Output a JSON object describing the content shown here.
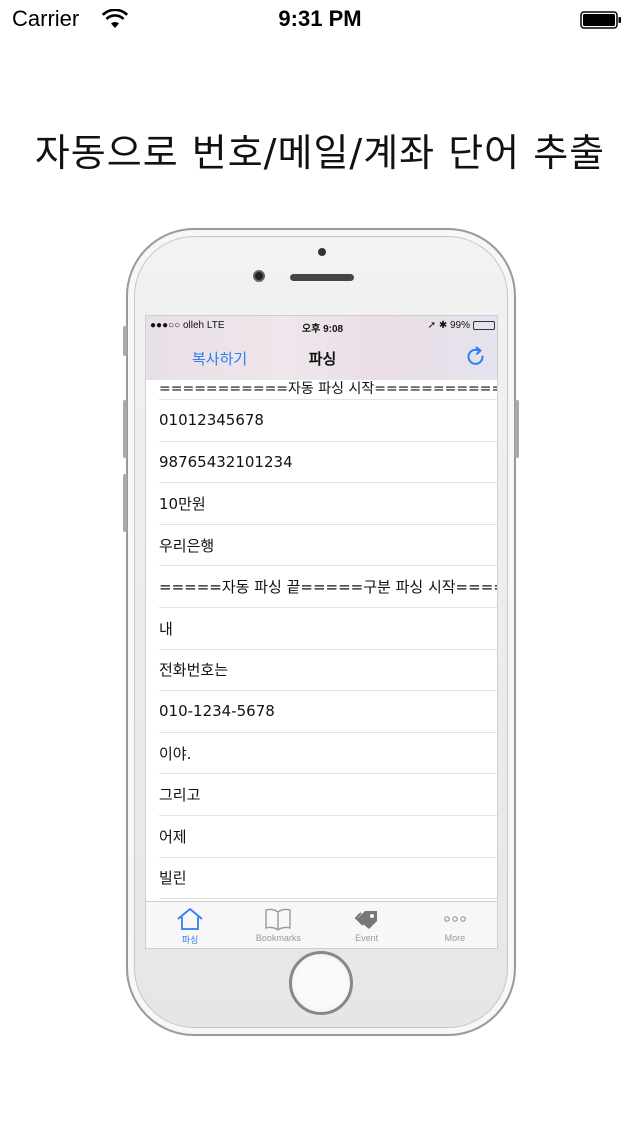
{
  "outer_status": {
    "carrier": "Carrier",
    "time": "9:31 PM"
  },
  "headline": "자동으로 번호/메일/계좌 단어 추출",
  "inner_status": {
    "carrier": "●●●○○ olleh  LTE",
    "time": "오후 9:08",
    "right": "➚ ✱ 99%"
  },
  "nav": {
    "left_button": "복사하기",
    "title": "파싱",
    "refresh_icon": "refresh-icon"
  },
  "list_rows": [
    "===========자동 파싱 시작============",
    "01012345678",
    "98765432101234",
    "10만원",
    "우리은행",
    "=====자동 파싱 끝=====구분 파싱 시작=====",
    "내",
    "전화번호는",
    "010-1234-5678",
    "이야.",
    "그리고",
    "어제",
    "빌린"
  ],
  "tabs": [
    {
      "label": "파싱",
      "icon": "home-icon",
      "active": true
    },
    {
      "label": "Bookmarks",
      "icon": "book-icon",
      "active": false
    },
    {
      "label": "Event",
      "icon": "tag-icon",
      "active": false
    },
    {
      "label": "More",
      "icon": "more-icon",
      "active": false
    }
  ],
  "colors": {
    "accent": "#2f7ef0",
    "battery": "#3ecb3e",
    "tab_inactive": "#9a9a9a"
  }
}
